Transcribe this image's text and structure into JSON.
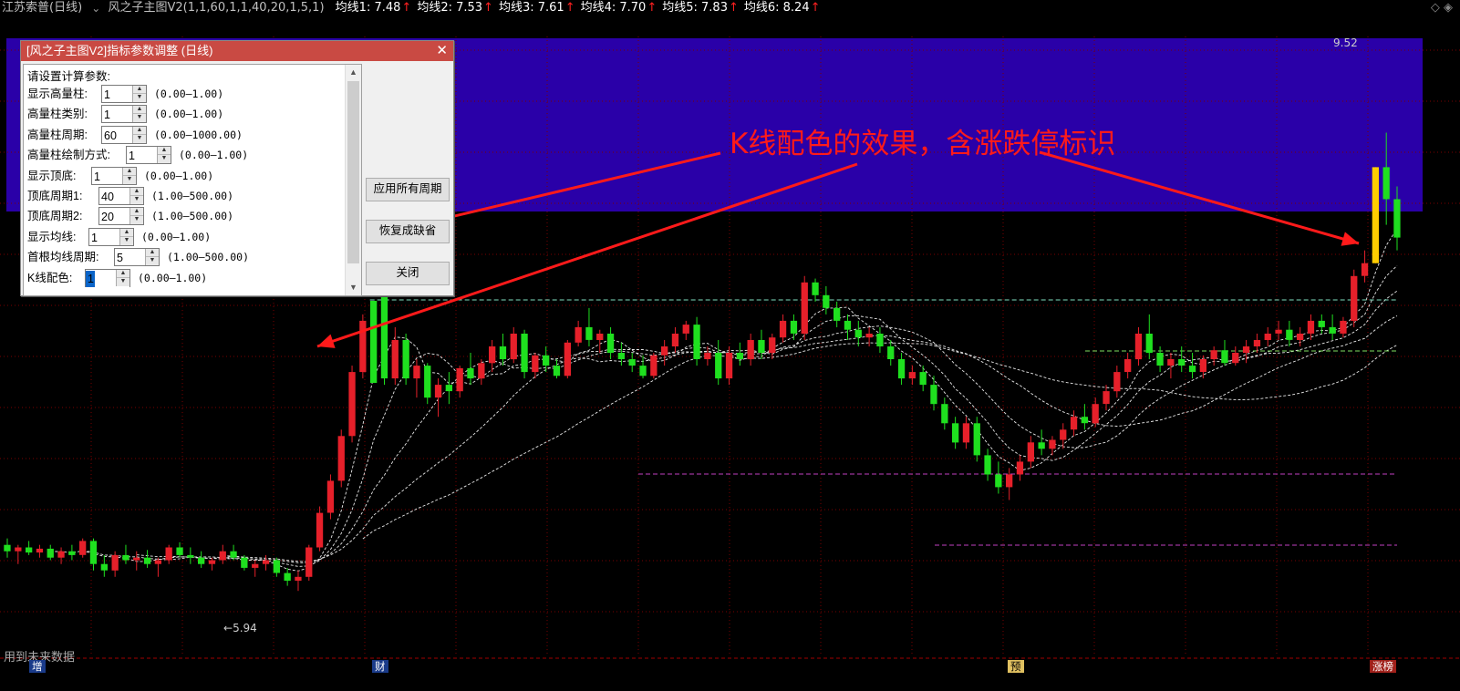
{
  "header": {
    "stock": "江苏索普(日线)",
    "indicator": "风之子主图V2(1,1,60,1,1,40,20,1,5,1)",
    "ma": [
      {
        "label": "均线1: 7.48",
        "color": "#ffffff"
      },
      {
        "label": "均线2: 7.53",
        "color": "#ffffff"
      },
      {
        "label": "均线3: 7.61",
        "color": "#ffffff"
      },
      {
        "label": "均线4: 7.70",
        "color": "#ffffff"
      },
      {
        "label": "均线5: 7.83",
        "color": "#ffffff"
      },
      {
        "label": "均线6: 8.24",
        "color": "#ffffff"
      }
    ],
    "right_icons": "◇ ◈"
  },
  "dialog": {
    "title": "[风之子主图V2]指标参数调整 (日线)",
    "close": "✕",
    "prompt": "请设置计算参数:",
    "params": [
      {
        "label": "显示高量柱:",
        "value": "1",
        "range": "(0.00—1.00)"
      },
      {
        "label": "高量柱类别:",
        "value": "1",
        "range": "(0.00—1.00)"
      },
      {
        "label": "高量柱周期:",
        "value": "60",
        "range": "(0.00—1000.00)"
      },
      {
        "label": "高量柱绘制方式:",
        "value": "1",
        "range": "(0.00—1.00)"
      },
      {
        "label": "显示顶底:",
        "value": "1",
        "range": "(0.00—1.00)"
      },
      {
        "label": "顶底周期1:",
        "value": "40",
        "range": "(1.00—500.00)"
      },
      {
        "label": "顶底周期2:",
        "value": "20",
        "range": "(1.00—500.00)"
      },
      {
        "label": "显示均线:",
        "value": "1",
        "range": "(0.00—1.00)"
      },
      {
        "label": "首根均线周期:",
        "value": "5",
        "range": "(1.00—500.00)"
      },
      {
        "label": "K线配色:",
        "value": "1",
        "range": "(0.00—1.00)"
      }
    ],
    "buttons": {
      "apply_all": "应用所有周期",
      "restore": "恢复成缺省",
      "close": "关闭"
    }
  },
  "annotation": "K线配色的效果，含涨跌停标识",
  "price_labels": {
    "high": "9.52",
    "low": "5.94"
  },
  "bottom_text": "用到未来数据",
  "bottom_marks": [
    {
      "label": "增",
      "color": "#ffffff",
      "bg": "#1a3b8a"
    },
    {
      "label": "财",
      "color": "#ffffff",
      "bg": "#1a3b8a"
    },
    {
      "label": "预",
      "color": "#000000",
      "bg": "#e0c060"
    },
    {
      "label": "涨榜",
      "color": "#ffffff",
      "bg": "#a0201a"
    }
  ],
  "colors": {
    "up": "#e6202a",
    "down": "#1fe01f",
    "limit_up": "#ffcc00",
    "banner": "#2a00a8",
    "grid": "#7a0000"
  },
  "chart_data": {
    "type": "candlestick",
    "ohlc": [
      [
        6.3,
        6.35,
        6.2,
        6.25
      ],
      [
        6.25,
        6.3,
        6.15,
        6.28
      ],
      [
        6.28,
        6.33,
        6.22,
        6.24
      ],
      [
        6.24,
        6.3,
        6.2,
        6.27
      ],
      [
        6.27,
        6.3,
        6.18,
        6.2
      ],
      [
        6.2,
        6.28,
        6.15,
        6.25
      ],
      [
        6.25,
        6.3,
        6.18,
        6.22
      ],
      [
        6.22,
        6.35,
        6.2,
        6.33
      ],
      [
        6.33,
        6.35,
        6.1,
        6.15
      ],
      [
        6.15,
        6.22,
        6.05,
        6.1
      ],
      [
        6.1,
        6.25,
        6.05,
        6.22
      ],
      [
        6.22,
        6.3,
        6.15,
        6.18
      ],
      [
        6.18,
        6.25,
        6.1,
        6.2
      ],
      [
        6.2,
        6.26,
        6.12,
        6.15
      ],
      [
        6.15,
        6.2,
        6.05,
        6.18
      ],
      [
        6.18,
        6.3,
        6.15,
        6.28
      ],
      [
        6.28,
        6.32,
        6.2,
        6.22
      ],
      [
        6.22,
        6.28,
        6.15,
        6.2
      ],
      [
        6.2,
        6.25,
        6.12,
        6.15
      ],
      [
        6.15,
        6.2,
        6.1,
        6.18
      ],
      [
        6.18,
        6.3,
        6.15,
        6.25
      ],
      [
        6.25,
        6.3,
        6.18,
        6.2
      ],
      [
        6.2,
        6.22,
        6.1,
        6.12
      ],
      [
        6.12,
        6.18,
        6.05,
        6.15
      ],
      [
        6.15,
        6.22,
        6.1,
        6.18
      ],
      [
        6.18,
        6.2,
        6.05,
        6.08
      ],
      [
        6.08,
        6.12,
        5.98,
        6.02
      ],
      [
        6.02,
        6.1,
        5.94,
        6.05
      ],
      [
        6.05,
        6.3,
        6.02,
        6.28
      ],
      [
        6.28,
        6.6,
        6.25,
        6.55
      ],
      [
        6.55,
        6.85,
        6.5,
        6.8
      ],
      [
        6.8,
        7.2,
        6.75,
        7.15
      ],
      [
        7.15,
        7.7,
        7.1,
        7.65
      ],
      [
        7.65,
        8.1,
        7.6,
        8.05
      ],
      [
        8.42,
        8.42,
        8.42,
        8.42
      ],
      [
        8.3,
        8.35,
        7.55,
        7.6
      ],
      [
        7.6,
        8.0,
        7.55,
        7.9
      ],
      [
        7.9,
        7.95,
        7.55,
        7.6
      ],
      [
        7.6,
        7.75,
        7.45,
        7.7
      ],
      [
        7.7,
        7.72,
        7.4,
        7.45
      ],
      [
        7.45,
        7.6,
        7.3,
        7.55
      ],
      [
        7.55,
        7.65,
        7.4,
        7.5
      ],
      [
        7.5,
        7.7,
        7.45,
        7.68
      ],
      [
        7.68,
        7.8,
        7.55,
        7.6
      ],
      [
        7.6,
        7.75,
        7.55,
        7.72
      ],
      [
        7.72,
        7.9,
        7.65,
        7.85
      ],
      [
        7.85,
        7.95,
        7.7,
        7.75
      ],
      [
        7.75,
        8.0,
        7.72,
        7.95
      ],
      [
        7.95,
        7.98,
        7.6,
        7.65
      ],
      [
        7.65,
        7.8,
        7.6,
        7.78
      ],
      [
        7.78,
        7.85,
        7.65,
        7.7
      ],
      [
        7.7,
        7.75,
        7.6,
        7.62
      ],
      [
        7.62,
        7.9,
        7.6,
        7.88
      ],
      [
        7.88,
        8.05,
        7.85,
        8.0
      ],
      [
        8.0,
        8.15,
        7.85,
        7.9
      ],
      [
        7.9,
        7.98,
        7.8,
        7.95
      ],
      [
        7.95,
        8.0,
        7.75,
        7.8
      ],
      [
        7.8,
        7.88,
        7.7,
        7.75
      ],
      [
        7.75,
        7.8,
        7.65,
        7.7
      ],
      [
        7.7,
        7.78,
        7.6,
        7.62
      ],
      [
        7.62,
        7.8,
        7.6,
        7.78
      ],
      [
        7.78,
        7.9,
        7.7,
        7.85
      ],
      [
        7.85,
        8.0,
        7.8,
        7.95
      ],
      [
        7.95,
        8.05,
        7.9,
        8.02
      ],
      [
        8.02,
        8.08,
        7.7,
        7.75
      ],
      [
        7.75,
        7.85,
        7.7,
        7.8
      ],
      [
        7.8,
        7.9,
        7.55,
        7.6
      ],
      [
        7.6,
        7.85,
        7.55,
        7.8
      ],
      [
        7.8,
        7.88,
        7.7,
        7.75
      ],
      [
        7.75,
        7.95,
        7.7,
        7.9
      ],
      [
        7.9,
        7.98,
        7.75,
        7.8
      ],
      [
        7.8,
        7.95,
        7.75,
        7.92
      ],
      [
        7.92,
        8.1,
        7.88,
        8.05
      ],
      [
        8.05,
        8.1,
        7.9,
        7.95
      ],
      [
        7.95,
        8.4,
        7.9,
        8.35
      ],
      [
        8.35,
        8.38,
        8.2,
        8.25
      ],
      [
        8.25,
        8.32,
        8.1,
        8.15
      ],
      [
        8.15,
        8.2,
        8.0,
        8.05
      ],
      [
        8.05,
        8.1,
        7.9,
        7.98
      ],
      [
        7.98,
        8.05,
        7.85,
        7.92
      ],
      [
        7.92,
        8.0,
        7.85,
        7.95
      ],
      [
        7.95,
        8.0,
        7.8,
        7.85
      ],
      [
        7.85,
        7.9,
        7.7,
        7.75
      ],
      [
        7.75,
        7.8,
        7.55,
        7.6
      ],
      [
        7.6,
        7.7,
        7.55,
        7.65
      ],
      [
        7.65,
        7.7,
        7.5,
        7.55
      ],
      [
        7.55,
        7.62,
        7.35,
        7.4
      ],
      [
        7.4,
        7.45,
        7.2,
        7.25
      ],
      [
        7.25,
        7.3,
        7.05,
        7.1
      ],
      [
        7.1,
        7.3,
        7.05,
        7.25
      ],
      [
        7.25,
        7.3,
        6.95,
        7.0
      ],
      [
        7.0,
        7.05,
        6.8,
        6.85
      ],
      [
        6.85,
        6.95,
        6.7,
        6.75
      ],
      [
        6.75,
        6.9,
        6.65,
        6.85
      ],
      [
        6.85,
        7.0,
        6.8,
        6.95
      ],
      [
        6.95,
        7.15,
        6.9,
        7.1
      ],
      [
        7.1,
        7.2,
        7.0,
        7.05
      ],
      [
        7.05,
        7.15,
        7.0,
        7.12
      ],
      [
        7.12,
        7.25,
        7.05,
        7.2
      ],
      [
        7.2,
        7.35,
        7.15,
        7.3
      ],
      [
        7.3,
        7.4,
        7.2,
        7.25
      ],
      [
        7.25,
        7.45,
        7.22,
        7.4
      ],
      [
        7.4,
        7.55,
        7.35,
        7.5
      ],
      [
        7.5,
        7.7,
        7.45,
        7.65
      ],
      [
        7.65,
        7.8,
        7.6,
        7.75
      ],
      [
        7.75,
        8.0,
        7.7,
        7.95
      ],
      [
        7.95,
        8.1,
        7.75,
        7.8
      ],
      [
        7.8,
        7.85,
        7.65,
        7.7
      ],
      [
        7.7,
        7.8,
        7.6,
        7.75
      ],
      [
        7.75,
        7.85,
        7.65,
        7.7
      ],
      [
        7.7,
        7.8,
        7.6,
        7.65
      ],
      [
        7.65,
        7.78,
        7.6,
        7.75
      ],
      [
        7.75,
        7.85,
        7.7,
        7.82
      ],
      [
        7.82,
        7.9,
        7.7,
        7.72
      ],
      [
        7.72,
        7.85,
        7.7,
        7.8
      ],
      [
        7.8,
        7.9,
        7.72,
        7.85
      ],
      [
        7.85,
        7.95,
        7.8,
        7.9
      ],
      [
        7.9,
        8.0,
        7.85,
        7.95
      ],
      [
        7.95,
        8.05,
        7.9,
        7.98
      ],
      [
        7.98,
        8.05,
        7.85,
        7.9
      ],
      [
        7.9,
        8.0,
        7.85,
        7.95
      ],
      [
        7.95,
        8.1,
        7.9,
        8.05
      ],
      [
        8.05,
        8.1,
        7.95,
        8.0
      ],
      [
        8.0,
        8.1,
        7.9,
        7.95
      ],
      [
        7.95,
        8.08,
        7.92,
        8.05
      ],
      [
        8.05,
        8.45,
        8.0,
        8.4
      ],
      [
        8.4,
        8.6,
        8.35,
        8.5
      ],
      [
        8.5,
        9.25,
        8.5,
        9.25
      ],
      [
        9.25,
        9.52,
        8.8,
        9.0
      ],
      [
        9.0,
        9.1,
        8.6,
        8.7
      ]
    ],
    "ylim": [
      5.5,
      10.2
    ]
  }
}
